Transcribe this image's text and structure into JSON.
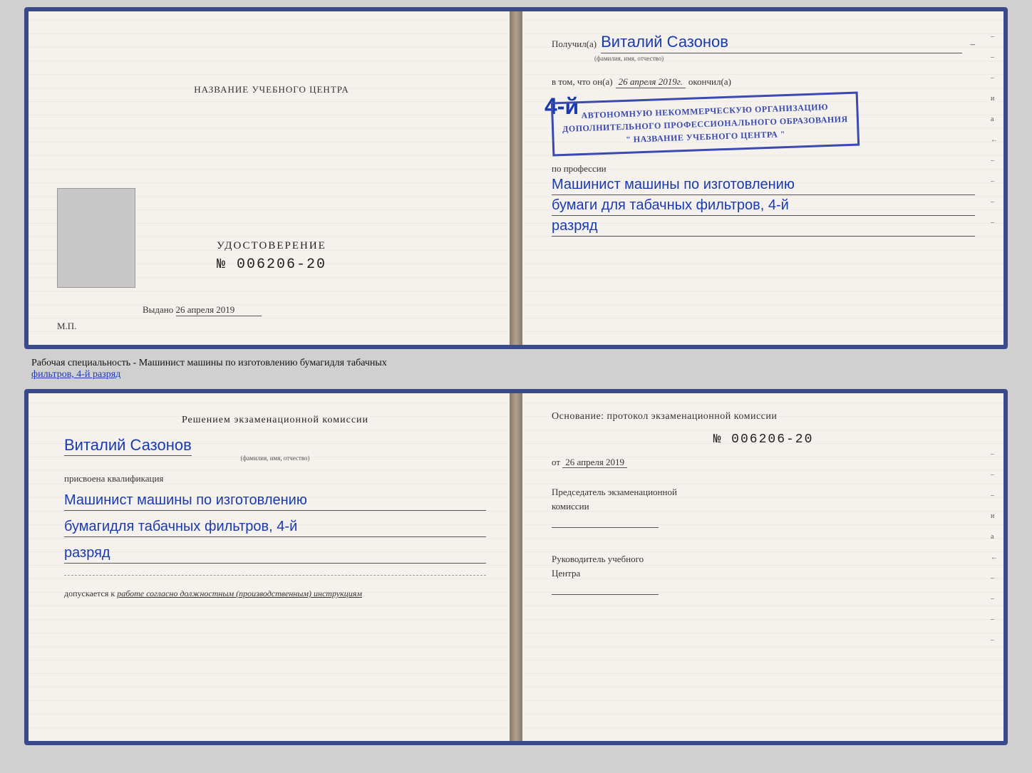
{
  "top_cert": {
    "left": {
      "school_name_label": "НАЗВАНИЕ УЧЕБНОГО ЦЕНТРА",
      "cert_title": "УДОСТОВЕРЕНИЕ",
      "cert_number": "№ 006206-20",
      "issued_prefix": "Выдано",
      "issued_date": "26 апреля 2019",
      "mp_label": "М.П."
    },
    "right": {
      "recipient_prefix": "Получил(а)",
      "recipient_name": "Виталий Сазонов",
      "recipient_subtitle": "(фамилия, имя, отчество)",
      "date_prefix": "в том, что он(а)",
      "date_value": "26 апреля 2019г.",
      "date_suffix": "окончил(а)",
      "stamp_num": "4-й",
      "stamp_line1": "АВТОНОМНУЮ НЕКОММЕРЧЕСКУЮ ОРГАНИЗАЦИЮ",
      "stamp_line2": "ДОПОЛНИТЕЛЬНОГО ПРОФЕССИОНАЛЬНОГО ОБРАЗОВАНИЯ",
      "stamp_line3": "\" НАЗВАНИЕ УЧЕБНОГО ЦЕНТРА \"",
      "profession_label": "по профессии",
      "profession_line1": "Машинист машины по изготовлению",
      "profession_line2": "бумаги для табачных фильтров, 4-й",
      "profession_line3": "разряд",
      "dash1": "–",
      "dash2": "–",
      "letter_i": "и",
      "letter_a": "а",
      "arrow": "←"
    }
  },
  "middle_label": {
    "prefix": "Рабочая специальность - Машинист машины по изготовлению бумагидля табачных",
    "underline_part": "фильтров, 4-й разряд"
  },
  "bottom_cert": {
    "left": {
      "commission_title": "Решением  экзаменационной  комиссии",
      "person_name": "Виталий Сазонов",
      "person_subtitle": "(фамилия, имя, отчество)",
      "qualification_label": "присвоена квалификация",
      "qual_line1": "Машинист машины по изготовлению",
      "qual_line2": "бумагидля табачных фильтров, 4-й",
      "qual_line3": "разряд",
      "допускается_label": "допускается к",
      "допускается_value": "работе согласно должностным (производственным) инструкциям"
    },
    "right": {
      "osnov_label": "Основание: протокол экзаменационной  комиссии",
      "protocol_number": "№ 006206-20",
      "date_prefix": "от",
      "date_value": "26 апреля 2019",
      "chairman_label_1": "Председатель экзаменационной",
      "chairman_label_2": "комиссии",
      "head_label_1": "Руководитель учебного",
      "head_label_2": "Центра",
      "dash1": "–",
      "dash2": "–",
      "letter_i": "и",
      "letter_a": "а",
      "arrow": "←"
    }
  }
}
